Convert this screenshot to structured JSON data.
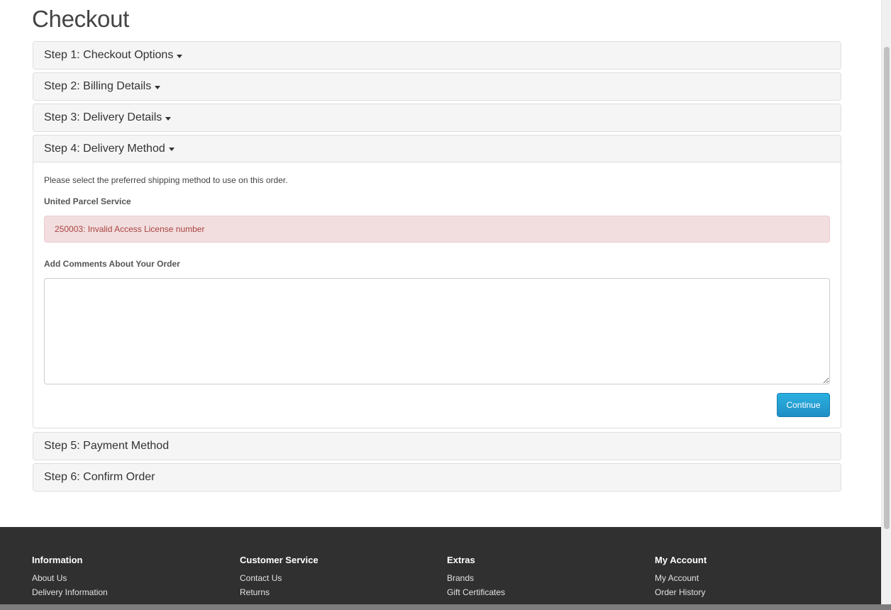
{
  "page": {
    "title": "Checkout"
  },
  "steps": [
    {
      "label": "Step 1: Checkout Options",
      "has_caret": true
    },
    {
      "label": "Step 2: Billing Details",
      "has_caret": true
    },
    {
      "label": "Step 3: Delivery Details",
      "has_caret": true
    },
    {
      "label": "Step 4: Delivery Method",
      "has_caret": true
    },
    {
      "label": "Step 5: Payment Method",
      "has_caret": false
    },
    {
      "label": "Step 6: Confirm Order",
      "has_caret": false
    }
  ],
  "delivery_method": {
    "intro": "Please select the preferred shipping method to use on this order.",
    "carrier": "United Parcel Service",
    "error": "250003: Invalid Access License number",
    "comments_label": "Add Comments About Your Order",
    "comments_value": "",
    "continue_label": "Continue"
  },
  "footer": {
    "columns": [
      {
        "heading": "Information",
        "links": [
          "About Us",
          "Delivery Information"
        ]
      },
      {
        "heading": "Customer Service",
        "links": [
          "Contact Us",
          "Returns"
        ]
      },
      {
        "heading": "Extras",
        "links": [
          "Brands",
          "Gift Certificates"
        ]
      },
      {
        "heading": "My Account",
        "links": [
          "My Account",
          "Order History"
        ]
      }
    ]
  },
  "colors": {
    "alert_bg": "#f2dede",
    "alert_text": "#a94442",
    "button_primary": "#229ac8",
    "footer_bg": "#303030"
  }
}
